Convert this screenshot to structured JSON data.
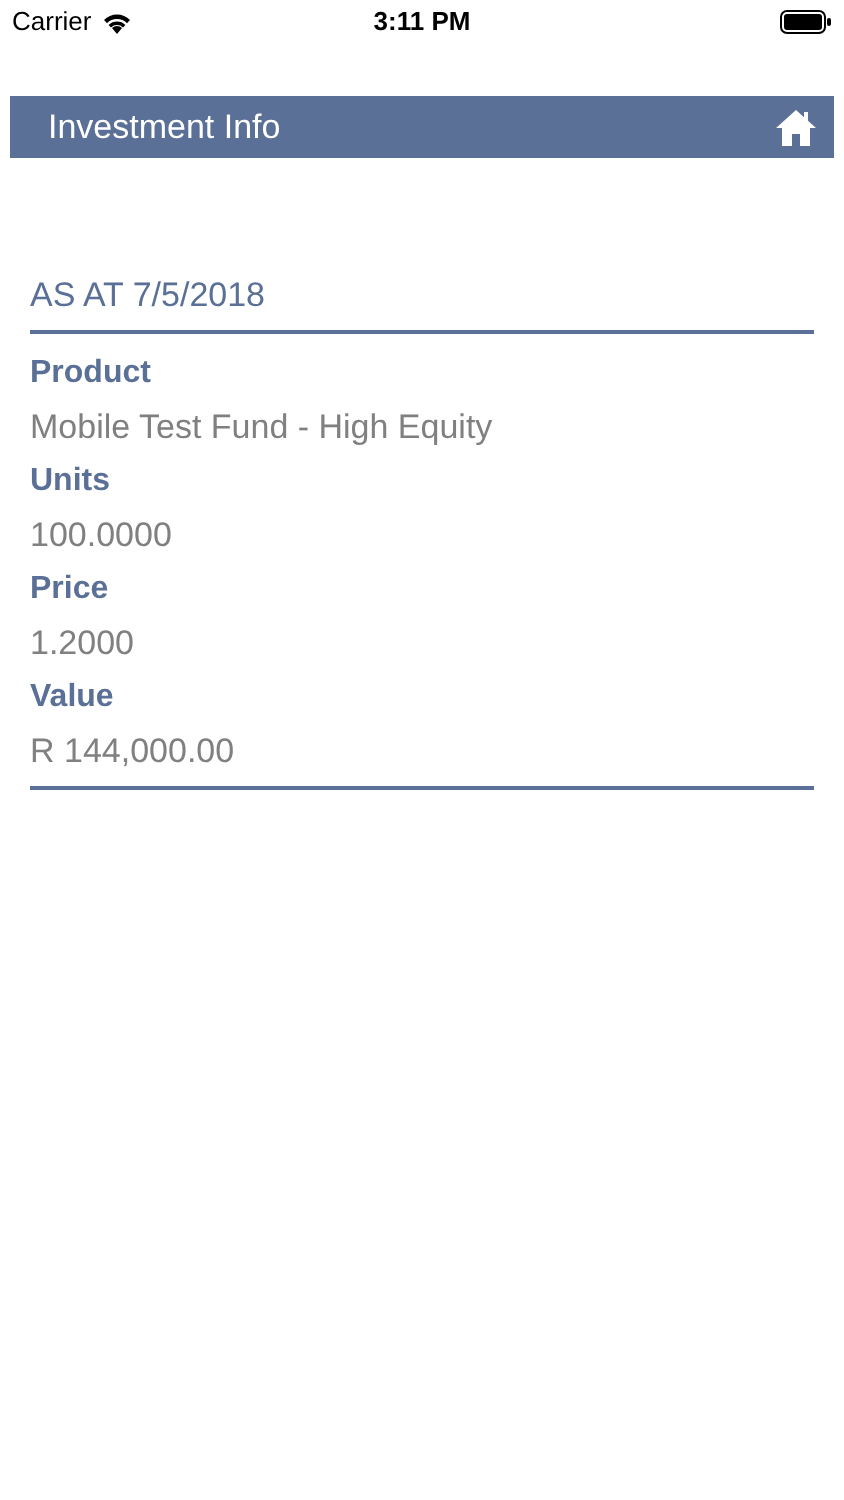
{
  "status_bar": {
    "carrier": "Carrier",
    "time": "3:11 PM"
  },
  "header": {
    "title": "Investment Info"
  },
  "section": {
    "title": "AS AT 7/5/2018",
    "fields": [
      {
        "label": "Product",
        "value": "Mobile Test Fund - High Equity"
      },
      {
        "label": "Units",
        "value": "100.0000"
      },
      {
        "label": "Price",
        "value": "1.2000"
      },
      {
        "label": "Value",
        "value": "R 144,000.00"
      }
    ]
  }
}
